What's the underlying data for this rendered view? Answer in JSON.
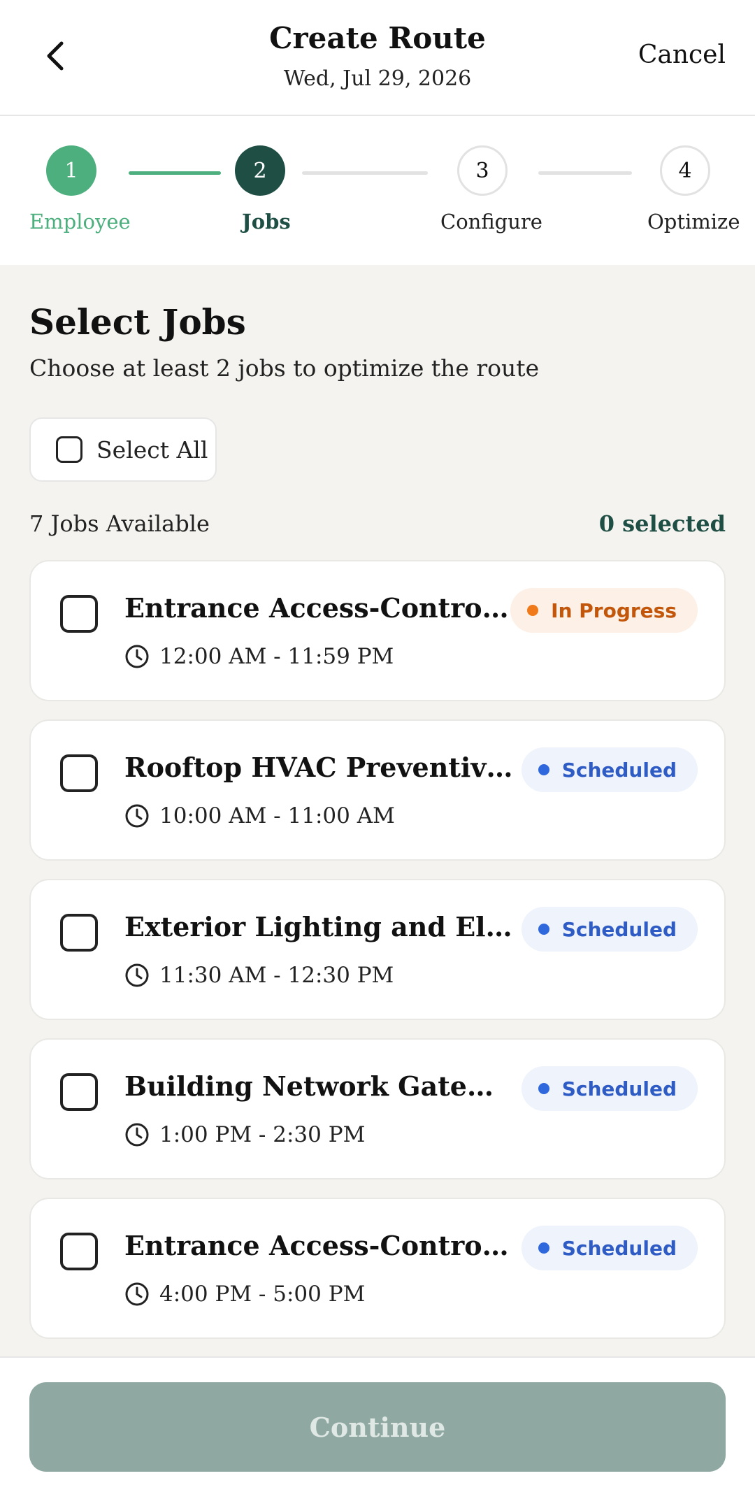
{
  "header": {
    "title": "Create Route",
    "date": "Wed, Jul 29, 2026",
    "cancel_label": "Cancel"
  },
  "stepper": {
    "steps": [
      {
        "number": "1",
        "label": "Employee",
        "state": "completed"
      },
      {
        "number": "2",
        "label": "Jobs",
        "state": "active"
      },
      {
        "number": "3",
        "label": "Configure",
        "state": "pending"
      },
      {
        "number": "4",
        "label": "Optimize",
        "state": "pending"
      }
    ]
  },
  "section": {
    "title": "Select Jobs",
    "subtitle": "Choose at least 2 jobs to optimize the route",
    "select_all_label": "Select All",
    "count_text": "7 Jobs Available",
    "selected_text": "0 selected"
  },
  "jobs": [
    {
      "title": "Entrance Access-Control Inspection",
      "time": "12:00 AM - 11:59 PM",
      "status": "In Progress",
      "status_type": "progress"
    },
    {
      "title": "Rooftop HVAC Preventive Maintenance",
      "time": "10:00 AM - 11:00 AM",
      "status": "Scheduled",
      "status_type": "scheduled"
    },
    {
      "title": "Exterior Lighting and Electrical Check",
      "time": "11:30 AM - 12:30 PM",
      "status": "Scheduled",
      "status_type": "scheduled"
    },
    {
      "title": "Building Network Gateway Maintenance",
      "time": "1:00 PM - 2:30 PM",
      "status": "Scheduled",
      "status_type": "scheduled"
    },
    {
      "title": "Entrance Access-Control Inspection",
      "time": "4:00 PM - 5:00 PM",
      "status": "Scheduled",
      "status_type": "scheduled"
    }
  ],
  "footer": {
    "continue_label": "Continue"
  },
  "colors": {
    "completed": "#4caf7d",
    "active": "#1f4f44",
    "pending_border": "#e2e2e2",
    "progress_bg": "#fdf0e6",
    "progress_text": "#c2570c",
    "progress_dot": "#f07a1a",
    "scheduled_bg": "#eef3fc",
    "scheduled_text": "#2f5cc4",
    "scheduled_dot": "#2f67dc",
    "continue_bg": "#8fa9a2",
    "continue_text": "#dfe8e5"
  }
}
